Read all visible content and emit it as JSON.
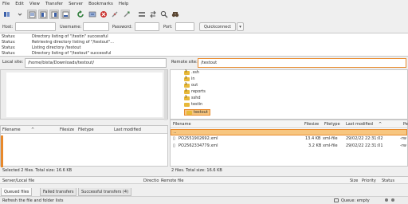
{
  "menu": [
    "File",
    "Edit",
    "View",
    "Transfer",
    "Server",
    "Bookmarks",
    "Help"
  ],
  "toolbar_icons": [
    "site-manager-icon",
    "toggle-log-icon",
    "toggle-local-tree-icon",
    "toggle-remote-tree-icon",
    "toggle-queue-icon",
    "refresh-icon",
    "process-queue-icon",
    "cancel-icon",
    "disconnect-icon",
    "reconnect-icon",
    "directory-compare-icon",
    "sync-browse-icon",
    "search-icon",
    "find-icon"
  ],
  "quickconnect": {
    "host_label": "Host:",
    "username_label": "Username:",
    "password_label": "Password:",
    "port_label": "Port:",
    "button_label": "Quickconnect",
    "dropdown_glyph": "▾"
  },
  "log": [
    {
      "key": "Status:",
      "text": "Directory listing of \"/testin\" successful"
    },
    {
      "key": "Status:",
      "text": "Retrieving directory listing of \"/testout\"..."
    },
    {
      "key": "Status:",
      "text": "Listing directory /testout"
    },
    {
      "key": "Status:",
      "text": "Directory listing of \"/testout\" successful"
    }
  ],
  "local": {
    "site_label": "Local site:",
    "path": "/home/bista/Downloads/testout/",
    "columns": {
      "filename": "Filename",
      "sort": "^",
      "filesize": "Filesize",
      "filetype": "Filetype",
      "modified": "Last modified"
    },
    "status": "Selected 2 files. Total size: 16.6 KB"
  },
  "remote": {
    "site_label": "Remote site:",
    "path": "/testout",
    "tree": [
      ".ssh",
      "in",
      "out",
      "reports",
      "sshd",
      "testin",
      "testout"
    ],
    "columns": {
      "filename": "Filename",
      "filesize": "Filesize",
      "filetype": "Filetype",
      "modified": "Last modified",
      "sort": "^",
      "perm": "Pe"
    },
    "parent_row": "..",
    "files": [
      {
        "name": "PO2551902692.xml",
        "size": "13.4 KB",
        "type": "xml-file",
        "modified": "29/02/22 22:31:02",
        "perm": "-rw"
      },
      {
        "name": "PO2562334779.xml",
        "size": "3.2 KB",
        "type": "xml-file",
        "modified": "29/02/22 22:31:01",
        "perm": "-rw"
      }
    ],
    "status": "2 files. Total size: 16.6 KB"
  },
  "queue": {
    "columns": {
      "server": "Server/Local file",
      "direction": "Directio",
      "remote": "Remote file",
      "size": "Size",
      "priority": "Priority",
      "status": "Status"
    },
    "tabs": [
      "Queued files",
      "Failed transfers",
      "Successful transfers (4)"
    ]
  },
  "statusbar": {
    "hint": "Refresh the file and folder lists",
    "queue": "Queue: empty"
  }
}
